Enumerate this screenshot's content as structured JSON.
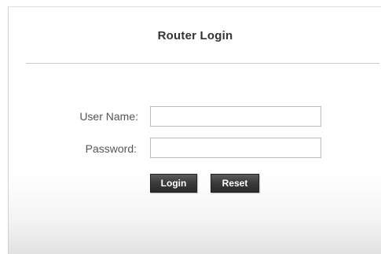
{
  "login": {
    "title": "Router Login",
    "username_label": "User Name:",
    "password_label": "Password:",
    "username_value": "",
    "password_value": "",
    "login_button": "Login",
    "reset_button": "Reset"
  }
}
